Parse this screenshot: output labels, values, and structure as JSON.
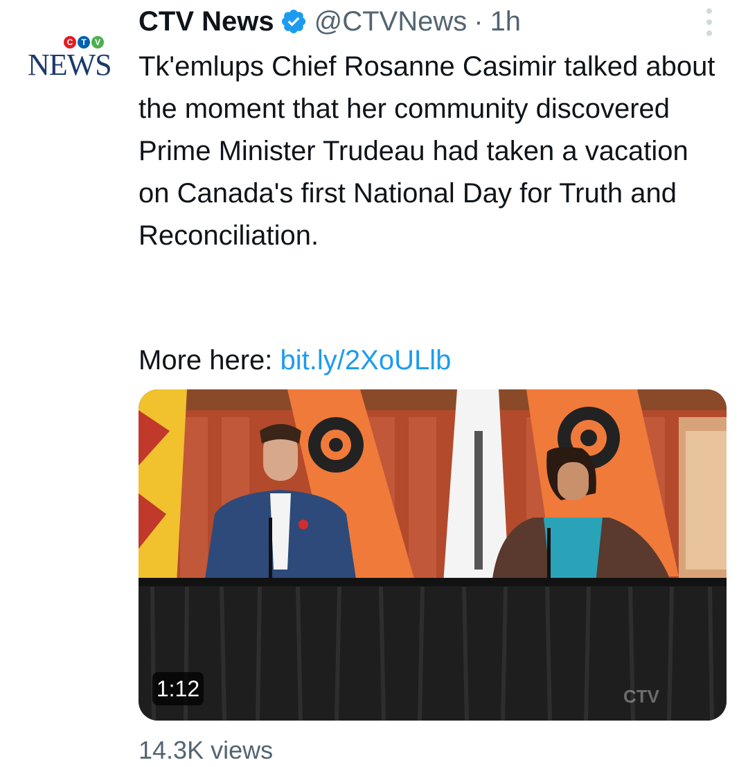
{
  "avatar": {
    "ctv_letters": [
      "C",
      "T",
      "V"
    ],
    "ctv_colors": [
      "#e31b23",
      "#0062b0",
      "#4caf50"
    ],
    "wordmark": "NEWS"
  },
  "header": {
    "display_name": "CTV News",
    "handle": "@CTVNews",
    "separator": "·",
    "time": "1h",
    "verified_color": "#1d9bf0"
  },
  "tweet": {
    "text": "Tk'emlups Chief Rosanne Casimir talked about the moment that her community discovered Prime Minister Trudeau had taken a vacation on Canada's first National Day for Truth and Reconciliation.",
    "more_label": "More here:",
    "link": "bit.ly/2XoULlb",
    "link_color": "#1d9bf0"
  },
  "video": {
    "duration": "1:12",
    "watermark": "CTV"
  },
  "stats": {
    "views": "14.3K views"
  }
}
